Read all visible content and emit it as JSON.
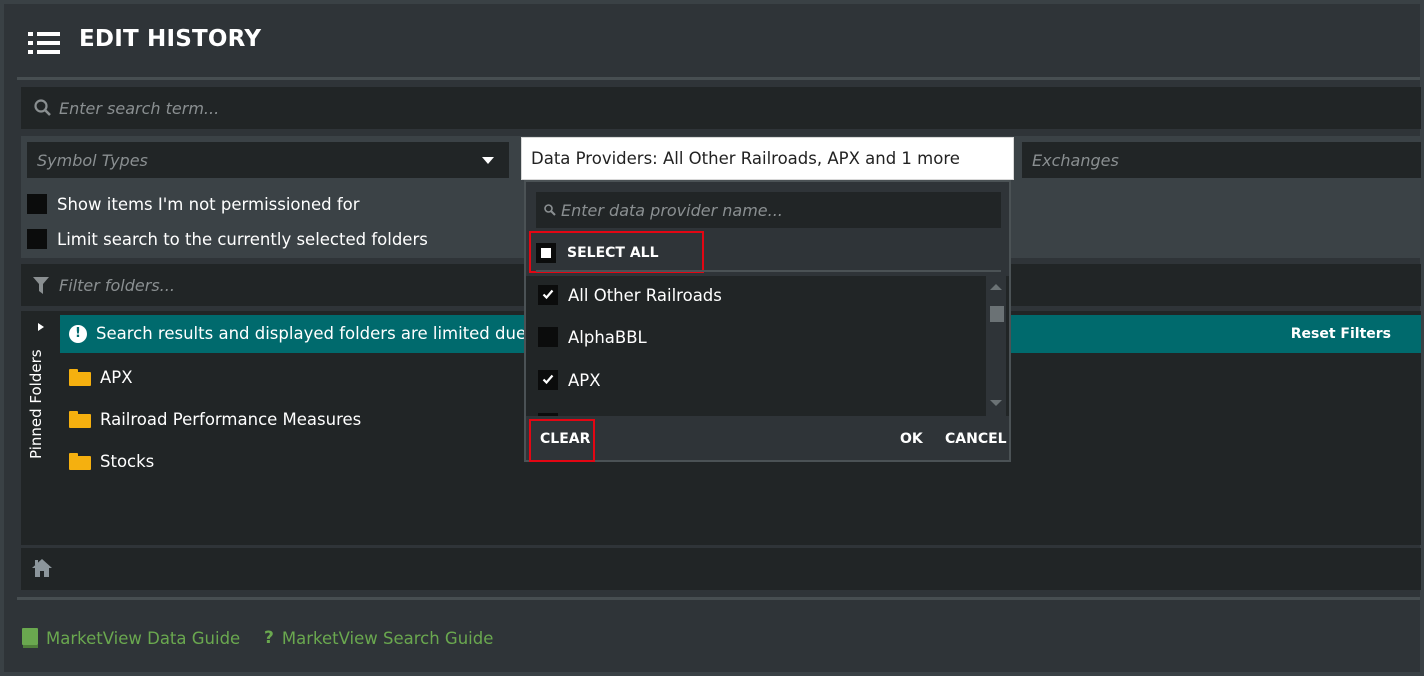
{
  "header": {
    "title": "EDIT HISTORY",
    "menu_icon": "list-menu-icon"
  },
  "search": {
    "placeholder": "Enter search term...",
    "icon": "search-icon"
  },
  "filters": {
    "symbol_types": {
      "placeholder": "Symbol Types",
      "icon": "caret-down-icon"
    },
    "exchanges": {
      "placeholder": "Exchanges"
    },
    "checkboxes": [
      {
        "label": "Show items I'm not permissioned for",
        "checked": false
      },
      {
        "label": "Limit search to the currently selected folders",
        "checked": false
      }
    ]
  },
  "folder_filter": {
    "placeholder": "Filter folders...",
    "icon": "filter-icon"
  },
  "pinned_folders": {
    "label": "Pinned Folders"
  },
  "banner": {
    "message": "Search results and displayed folders are limited due to",
    "reset_label": "Reset Filters",
    "icon": "info-icon",
    "color": "#006a6d"
  },
  "folders": [
    {
      "label": "APX",
      "icon": "folder-icon"
    },
    {
      "label": "Railroad Performance Measures",
      "icon": "folder-icon"
    },
    {
      "label": "Stocks",
      "icon": "folder-icon"
    }
  ],
  "home": {
    "icon": "home-icon"
  },
  "footer": {
    "links": [
      {
        "label": "MarketView Data Guide",
        "icon": "book-icon"
      },
      {
        "label": "MarketView Search Guide",
        "icon": "question-icon"
      }
    ],
    "link_color": "#6aa84f"
  },
  "data_providers": {
    "summary": "Data Providers: All Other Railroads, APX and 1 more",
    "search_placeholder": "Enter data provider name...",
    "select_all_label": "SELECT ALL",
    "select_all_state": "partial",
    "items": [
      {
        "label": "All Other Railroads",
        "checked": true
      },
      {
        "label": "AlphaBBL",
        "checked": false
      },
      {
        "label": "APX",
        "checked": true
      }
    ],
    "clear_label": "CLEAR",
    "ok_label": "OK",
    "cancel_label": "CANCEL",
    "highlight_color": "#e30613"
  }
}
